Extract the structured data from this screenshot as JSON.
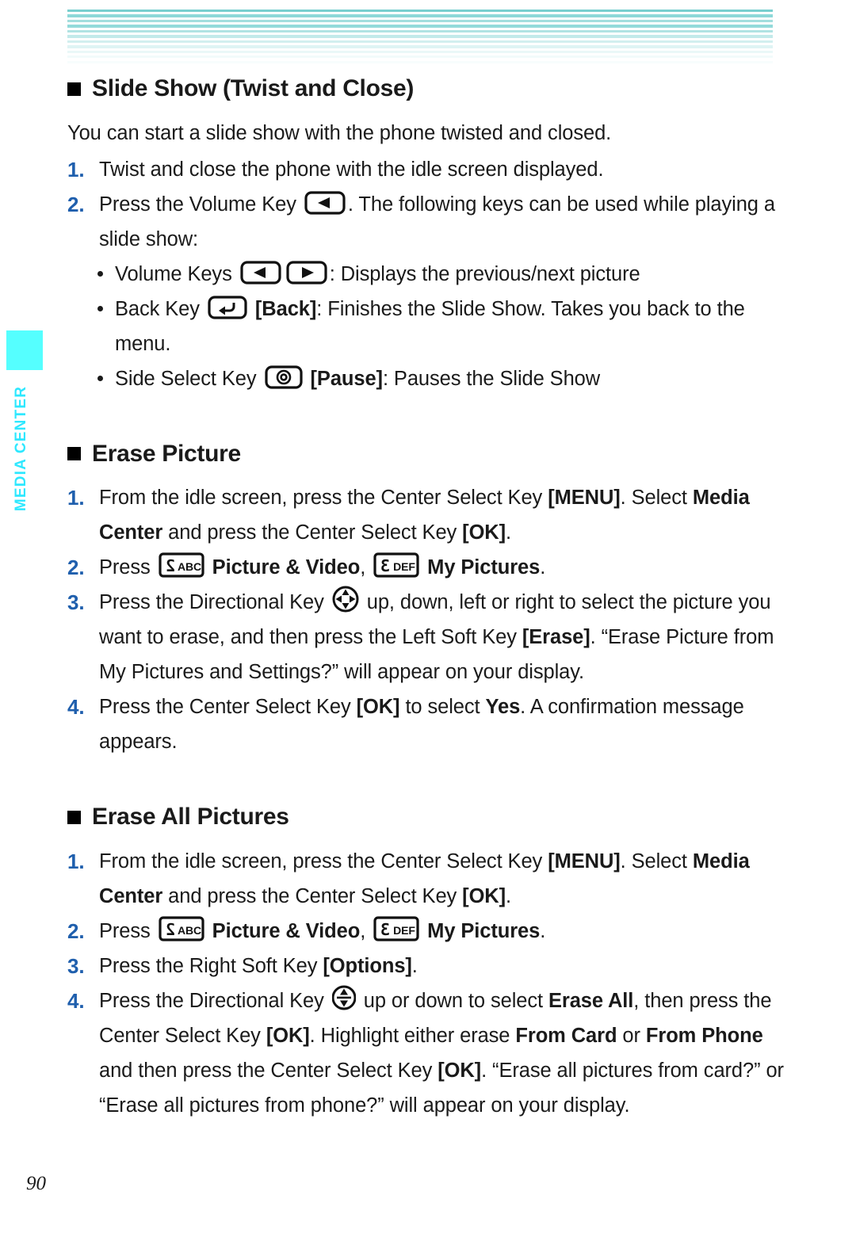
{
  "page": {
    "number": "90",
    "side_tab_label": "MEDIA CENTER",
    "accent_cyan": "#55ffff",
    "accent_stripe": "#7dd3d3",
    "step_number_color": "#1f5fad"
  },
  "header_stripes": {
    "name": "decorative-stripe-band",
    "colors": [
      "#79cfcf",
      "#ffffff",
      "#8ed8d8",
      "#ffffff",
      "#a3dede",
      "#ffffff",
      "#93dada",
      "#ffffff",
      "#b0e3e3",
      "#ffffff",
      "#c2eaea",
      "#ffffff",
      "#d2efef",
      "#ffffff",
      "#dff4f4",
      "#ffffff",
      "#eaf8f8",
      "#ffffff",
      "#f2fbfb",
      "#ffffff",
      "#f8fdfd"
    ]
  },
  "sections": [
    {
      "id": "slide-show",
      "heading": "Slide Show (Twist and Close)",
      "intro": "You can start a slide show with the phone twisted and closed.",
      "steps": [
        {
          "num": "1.",
          "parts": [
            {
              "t": "Twist and close the phone with the idle screen displayed."
            }
          ]
        },
        {
          "num": "2.",
          "parts": [
            {
              "t": "Press the Volume Key "
            },
            {
              "icon": "volume-key-left-icon"
            },
            {
              "t": ". The following keys can be used while playing a slide show:"
            }
          ]
        }
      ],
      "bullets": [
        {
          "parts": [
            {
              "t": "Volume Keys "
            },
            {
              "icon": "volume-key-left-icon"
            },
            {
              "icon": "volume-key-right-icon"
            },
            {
              "t": ": Displays the previous/next picture"
            }
          ]
        },
        {
          "parts": [
            {
              "t": "Back Key "
            },
            {
              "icon": "back-key-icon"
            },
            {
              "t": " "
            },
            {
              "b": "[Back]"
            },
            {
              "t": ": Finishes the Slide Show. Takes you back to the menu."
            }
          ]
        },
        {
          "parts": [
            {
              "t": "Side Select Key "
            },
            {
              "icon": "side-select-key-icon"
            },
            {
              "t": " "
            },
            {
              "b": "[Pause]"
            },
            {
              "t": ": Pauses the Slide Show"
            }
          ]
        }
      ]
    },
    {
      "id": "erase-picture",
      "heading": "Erase Picture",
      "steps": [
        {
          "num": "1.",
          "parts": [
            {
              "t": "From the idle screen, press the Center Select Key "
            },
            {
              "b": "[MENU]"
            },
            {
              "t": ". Select "
            },
            {
              "b": "Media Center"
            },
            {
              "t": " and press the Center Select Key "
            },
            {
              "b": "[OK]"
            },
            {
              "t": "."
            }
          ]
        },
        {
          "num": "2.",
          "parts": [
            {
              "t": "Press "
            },
            {
              "icon": "keypad-2-abc-icon"
            },
            {
              "t": " "
            },
            {
              "b": "Picture & Video"
            },
            {
              "t": ", "
            },
            {
              "icon": "keypad-3-def-icon"
            },
            {
              "t": " "
            },
            {
              "b": "My Pictures"
            },
            {
              "t": "."
            }
          ]
        },
        {
          "num": "3.",
          "parts": [
            {
              "t": "Press the Directional Key "
            },
            {
              "icon": "directional-key-4way-icon"
            },
            {
              "t": " up, down, left or right to select the picture you want to erase, and then press the Left Soft Key "
            },
            {
              "b": "[Erase]"
            },
            {
              "t": ". “Erase Picture from My Pictures and Settings?” will appear on your display."
            }
          ]
        },
        {
          "num": "4.",
          "parts": [
            {
              "t": "Press the Center Select Key "
            },
            {
              "b": "[OK]"
            },
            {
              "t": " to select "
            },
            {
              "b": "Yes"
            },
            {
              "t": ". A confirmation message appears."
            }
          ]
        }
      ]
    },
    {
      "id": "erase-all-pictures",
      "heading": "Erase All Pictures",
      "steps": [
        {
          "num": "1.",
          "parts": [
            {
              "t": "From the idle screen, press the Center Select Key "
            },
            {
              "b": "[MENU]"
            },
            {
              "t": ". Select "
            },
            {
              "b": "Media Center"
            },
            {
              "t": " and press the Center Select Key "
            },
            {
              "b": "[OK]"
            },
            {
              "t": "."
            }
          ]
        },
        {
          "num": "2.",
          "parts": [
            {
              "t": "Press "
            },
            {
              "icon": "keypad-2-abc-icon"
            },
            {
              "t": " "
            },
            {
              "b": "Picture & Video"
            },
            {
              "t": ", "
            },
            {
              "icon": "keypad-3-def-icon"
            },
            {
              "t": " "
            },
            {
              "b": "My Pictures"
            },
            {
              "t": "."
            }
          ]
        },
        {
          "num": "3.",
          "parts": [
            {
              "t": "Press the Right Soft Key "
            },
            {
              "b": "[Options]"
            },
            {
              "t": "."
            }
          ]
        },
        {
          "num": "4.",
          "parts": [
            {
              "t": "Press the Directional Key "
            },
            {
              "icon": "directional-key-updown-icon"
            },
            {
              "t": " up or down to select "
            },
            {
              "b": "Erase All"
            },
            {
              "t": ", then press the Center Select Key "
            },
            {
              "b": "[OK]"
            },
            {
              "t": ". Highlight either erase "
            },
            {
              "b": "From Card"
            },
            {
              "t": " or "
            },
            {
              "b": "From Phone"
            },
            {
              "t": " and then press the Center Select Key "
            },
            {
              "b": "[OK]"
            },
            {
              "t": ". “Erase all pictures from card?” or “Erase all pictures from phone?” will appear on your display."
            }
          ]
        }
      ]
    }
  ],
  "icon_labels": {
    "keypad-2-abc-icon": {
      "digit": "2",
      "letters": "ABC"
    },
    "keypad-3-def-icon": {
      "digit": "3",
      "letters": "DEF"
    }
  }
}
